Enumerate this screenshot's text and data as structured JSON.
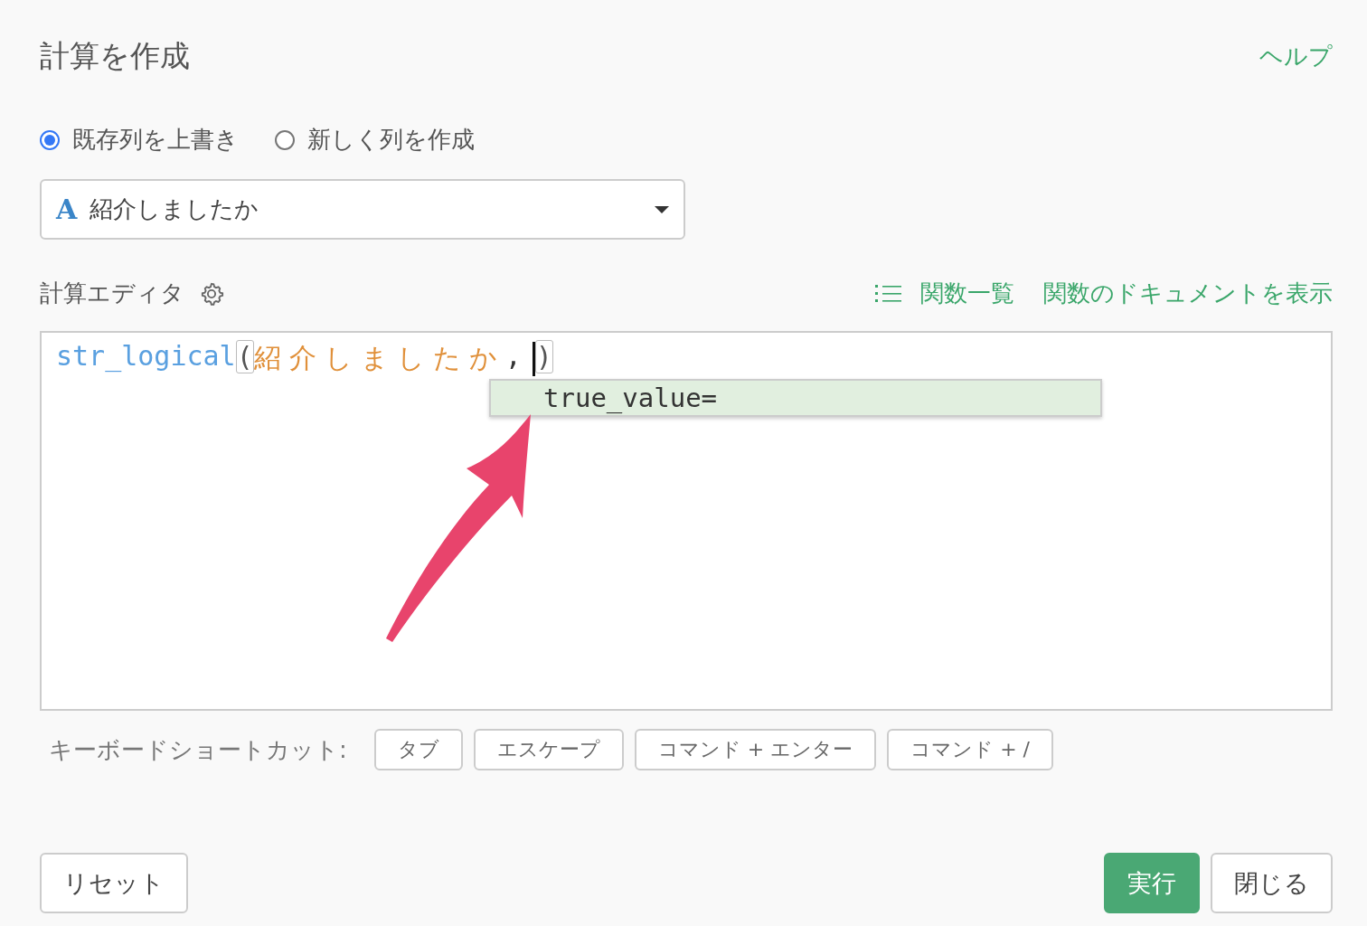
{
  "dialog": {
    "title": "計算を作成",
    "help_link": "ヘルプ"
  },
  "mode_options": [
    {
      "label": "既存列を上書き",
      "selected": true
    },
    {
      "label": "新しく列を作成",
      "selected": false
    }
  ],
  "column_select": {
    "type_icon": "A",
    "value": "紹介しましたか"
  },
  "editor": {
    "label": "計算エディタ",
    "links": [
      "関数一覧",
      "関数のドキュメントを表示"
    ],
    "tokens": [
      {
        "kind": "function",
        "text": "str_logical"
      },
      {
        "kind": "paren",
        "text": "("
      },
      {
        "kind": "column",
        "text": "紹介しましたか"
      },
      {
        "kind": "punct",
        "text": ","
      },
      {
        "kind": "cursor"
      },
      {
        "kind": "paren",
        "text": ")"
      }
    ],
    "suggestions": [
      {
        "text": "true_value=",
        "selected": true
      }
    ]
  },
  "shortcuts": {
    "label": "キーボードショートカット:",
    "keys": [
      "タブ",
      "エスケープ",
      "コマンド + エンター",
      "コマンド + /"
    ]
  },
  "buttons": [
    {
      "kind": "reset",
      "label": "リセット"
    },
    {
      "kind": "primary",
      "label": "実行"
    },
    {
      "kind": "secondary",
      "label": "閉じる"
    }
  ]
}
